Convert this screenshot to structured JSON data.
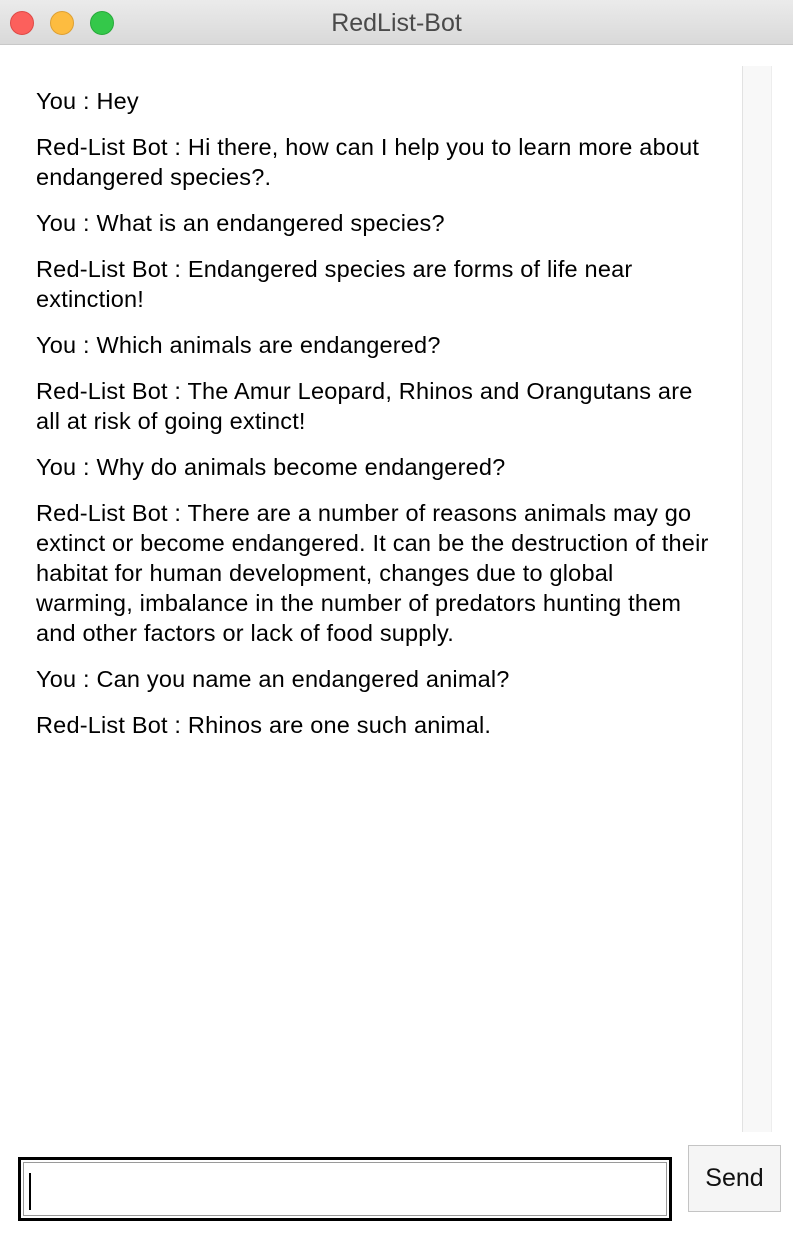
{
  "window": {
    "title": "RedList-Bot"
  },
  "chat": {
    "messages": [
      {
        "text": "You : Hey"
      },
      {
        "text": "Red-List Bot : Hi there, how can I help you to learn more about endangered species?."
      },
      {
        "text": "You : What is an endangered species?"
      },
      {
        "text": "Red-List Bot : Endangered species are forms of life near extinction!"
      },
      {
        "text": "You : Which animals are endangered?"
      },
      {
        "text": "Red-List Bot : The Amur Leopard, Rhinos and Orangutans are all at risk of going extinct!"
      },
      {
        "text": "You : Why do animals become endangered?"
      },
      {
        "text": "Red-List Bot : There are a number of reasons animals may go extinct or become endangered. It can be the destruction of their habitat for human development, changes due to global warming, imbalance in the number of predators hunting them and other factors or lack of food supply."
      },
      {
        "text": "You : Can you name an endangered animal?"
      },
      {
        "text": "Red-List Bot : Rhinos are one such animal."
      }
    ]
  },
  "composer": {
    "input_value": "",
    "send_label": "Send"
  },
  "colors": {
    "close": "#fc605c",
    "minimize": "#fdbc40",
    "zoom": "#34c84a"
  }
}
